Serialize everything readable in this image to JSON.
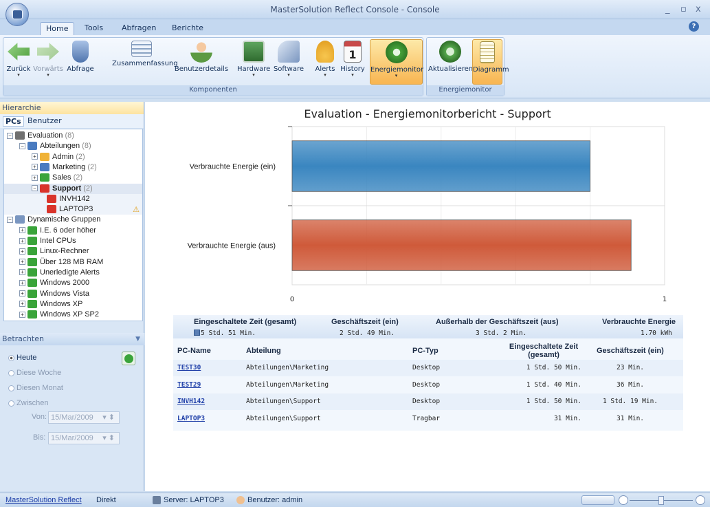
{
  "window": {
    "title": "MasterSolution Reflect Console - Console",
    "minimize": "_",
    "maximize": "▫",
    "close": "x"
  },
  "tabs": [
    "Home",
    "Tools",
    "Abfragen",
    "Berichte"
  ],
  "help": "?",
  "ribbon": {
    "buttons": [
      {
        "label": "Zurück",
        "icon": "back-arrow-icon",
        "color": "#5fb34a"
      },
      {
        "label": "Vorwärts",
        "icon": "forward-arrow-icon",
        "color": "#9fc78f",
        "disabled": true
      },
      {
        "label": "Abfrage",
        "icon": "query-icon",
        "color": "#6d8fbf"
      },
      {
        "label": "Zusammenfassung",
        "icon": "summary-icon",
        "color": "#8aa3c4"
      },
      {
        "label": "Benutzerdetails",
        "icon": "user-details-icon",
        "color": "#5c9a43"
      },
      {
        "label": "Hardware",
        "icon": "hardware-icon",
        "color": "#3d7a3d"
      },
      {
        "label": "Software",
        "icon": "software-icon",
        "color": "#7a96c0"
      },
      {
        "label": "Alerts",
        "icon": "alerts-bell-icon",
        "color": "#f0b236"
      },
      {
        "label": "History",
        "icon": "calendar-icon",
        "color": "#f4f4f4"
      },
      {
        "label": "Energiemonitor",
        "icon": "power-icon",
        "color": "#48a23b"
      },
      {
        "label": "Aktualisieren",
        "icon": "refresh-icon",
        "color": "#57a84d"
      },
      {
        "label": "Diagramm",
        "icon": "diagram-icon",
        "color": "#eedc8a"
      }
    ],
    "group1": "Komponenten",
    "group2": "Energiemonitor"
  },
  "left": {
    "header": "Hierarchie",
    "tabs": [
      "PCs",
      "Benutzer"
    ],
    "tree": [
      {
        "label": "Evaluation",
        "count": "(8)"
      },
      {
        "label": "Abteilungen",
        "count": "(8)"
      },
      {
        "label": "Admin",
        "count": "(2)"
      },
      {
        "label": "Marketing",
        "count": "(2)"
      },
      {
        "label": "Sales",
        "count": "(2)"
      },
      {
        "label": "Support",
        "count": "(2)"
      },
      {
        "label": "INVH142",
        "count": ""
      },
      {
        "label": "LAPTOP3",
        "count": ""
      },
      {
        "label": "Dynamische Gruppen",
        "count": ""
      },
      {
        "label": "I.E. 6 oder höher",
        "count": ""
      },
      {
        "label": "Intel CPUs",
        "count": ""
      },
      {
        "label": "Linux-Rechner",
        "count": ""
      },
      {
        "label": "Über 128 MB RAM",
        "count": ""
      },
      {
        "label": "Unerledigte Alerts",
        "count": ""
      },
      {
        "label": "Windows 2000",
        "count": ""
      },
      {
        "label": "Windows Vista",
        "count": ""
      },
      {
        "label": "Windows XP",
        "count": ""
      },
      {
        "label": "Windows XP SP2",
        "count": ""
      }
    ],
    "betrachten": "Betrachten",
    "radios": [
      "Heute",
      "Diese Woche",
      "Diesen Monat",
      "Zwischen"
    ],
    "von_label": "Von:",
    "bis_label": "Bis:",
    "von_value": "15/Mar/2009",
    "bis_value": "15/Mar/2009"
  },
  "report": {
    "title": "Evaluation - Energiemonitorbericht - Support"
  },
  "chart_data": {
    "type": "bar",
    "orientation": "horizontal",
    "categories": [
      "Verbrauchte Energie (ein)",
      "Verbrauchte Energie (aus)"
    ],
    "values": [
      0.8,
      0.91
    ],
    "colors": [
      "#3a86c0",
      "#cf5a3a"
    ],
    "xlim": [
      0,
      1
    ],
    "xticks": [
      "0",
      "1"
    ]
  },
  "summary": {
    "headers": [
      "Eingeschaltete Zeit (gesamt)",
      "Geschäftszeit (ein)",
      "Außerhalb der Geschäftszeit (aus)",
      "Verbrauchte Energie"
    ],
    "values": [
      "5 Std. 51 Min.",
      "2 Std. 49 Min.",
      "3 Std. 2 Min.",
      "1.70 kWh"
    ]
  },
  "table": {
    "columns": [
      "PC-Name",
      "Abteilung",
      "PC-Typ",
      "Eingeschaltete Zeit (gesamt)",
      "Geschäftszeit (ein)"
    ],
    "rows": [
      [
        "TEST30",
        "Abteilungen\\Marketing",
        "Desktop",
        "1 Std. 50 Min.",
        "23 Min."
      ],
      [
        "TEST29",
        "Abteilungen\\Marketing",
        "Desktop",
        "1 Std. 40 Min.",
        "36 Min."
      ],
      [
        "INVH142",
        "Abteilungen\\Support",
        "Desktop",
        "1 Std. 50 Min.",
        "1 Std. 19 Min."
      ],
      [
        "LAPTOP3",
        "Abteilungen\\Support",
        "Tragbar",
        "31 Min.",
        "31 Min."
      ]
    ]
  },
  "status": {
    "app": "MasterSolution Reflect",
    "mode": "Direkt",
    "server": "Server: LAPTOP3",
    "user": "Benutzer: admin"
  }
}
